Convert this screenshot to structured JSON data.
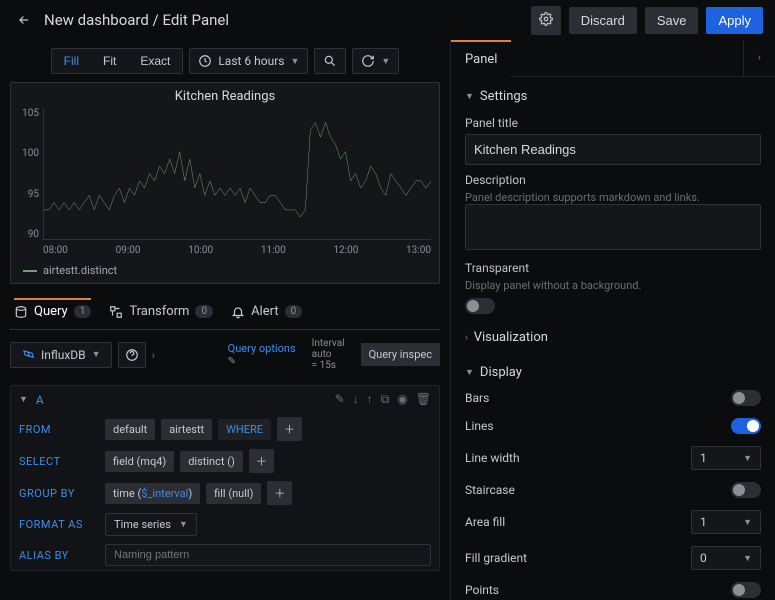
{
  "header": {
    "breadcrumb": "New dashboard / Edit Panel",
    "discard": "Discard",
    "save": "Save",
    "apply": "Apply"
  },
  "toolbar": {
    "fill": "Fill",
    "fit": "Fit",
    "exact": "Exact",
    "timerange": "Last 6 hours"
  },
  "chart": {
    "title": "Kitchen Readings",
    "legend": "airtestt.distinct"
  },
  "chart_data": {
    "type": "line",
    "title": "Kitchen Readings",
    "y_ticks": [
      105,
      100,
      95,
      90
    ],
    "ylim": [
      88,
      106
    ],
    "x_ticks": [
      "08:00",
      "09:00",
      "10:00",
      "11:00",
      "12:00",
      "13:00"
    ],
    "series": [
      {
        "name": "airtestt.distinct",
        "color": "#73a16e",
        "values": [
          92,
          92,
          93,
          92,
          93,
          92,
          93,
          92,
          93,
          94,
          92,
          94,
          93,
          92,
          94,
          95,
          93,
          95,
          94,
          96,
          95,
          97,
          96,
          98,
          97,
          99,
          97,
          100,
          96,
          99,
          95,
          97,
          94,
          96,
          94,
          95,
          94,
          95,
          94,
          95,
          93,
          95,
          94,
          93,
          93,
          94,
          94,
          93,
          92,
          92,
          92,
          91,
          92,
          103,
          104,
          102,
          104,
          102,
          101,
          99,
          100,
          96,
          97,
          95,
          96,
          98,
          97,
          95,
          94,
          97,
          96,
          95,
          94,
          95,
          96,
          96,
          95,
          96
        ]
      }
    ]
  },
  "tabs": {
    "query": "Query",
    "query_count": "1",
    "transform": "Transform",
    "transform_count": "0",
    "alert": "Alert",
    "alert_count": "0"
  },
  "datasource": "InfluxDB",
  "queryopts": {
    "label": "Query options",
    "interval_label": "Interval",
    "auto": "auto",
    "eq": "= 15s",
    "inspector": "Query inspec"
  },
  "query": {
    "name": "A",
    "from_label": "FROM",
    "from_default": "default",
    "from_meas": "airtestt",
    "where": "WHERE",
    "select_label": "SELECT",
    "select_field": "field (mq4)",
    "select_agg": "distinct ()",
    "groupby_label": "GROUP BY",
    "groupby_time_prefix": "time (",
    "groupby_time_var": "$_interval",
    "groupby_time_suffix": ")",
    "groupby_fill": "fill (null)",
    "format_label": "FORMAT AS",
    "format_value": "Time series",
    "alias_label": "ALIAS BY",
    "alias_placeholder": "Naming pattern"
  },
  "panel": {
    "tab": "Panel",
    "settings": "Settings",
    "title_label": "Panel title",
    "title_value": "Kitchen Readings",
    "desc_label": "Description",
    "desc_hint": "Panel description supports markdown and links.",
    "transparent": "Transparent",
    "transparent_hint": "Display panel without a background.",
    "visualization": "Visualization",
    "display": "Display",
    "rows": {
      "bars": "Bars",
      "lines": "Lines",
      "linewidth": "Line width",
      "staircase": "Staircase",
      "areafill": "Area fill",
      "fillgrad": "Fill gradient",
      "points": "Points"
    },
    "values": {
      "linewidth": "1",
      "areafill": "1",
      "fillgrad": "0"
    }
  }
}
